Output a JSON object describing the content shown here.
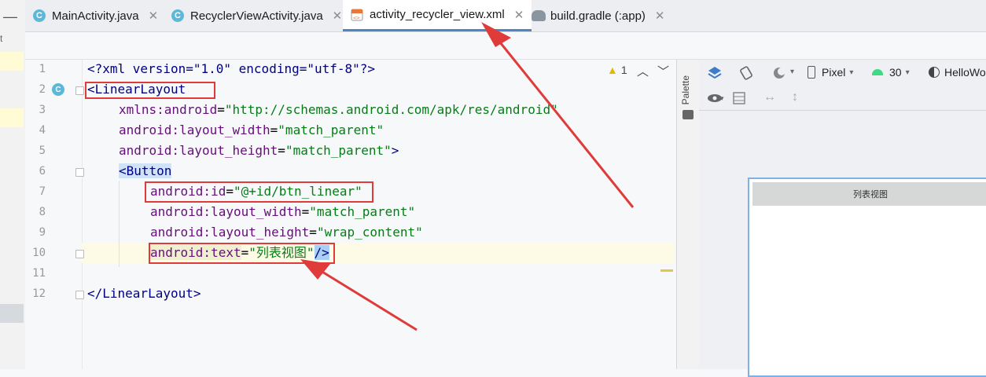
{
  "tabs": [
    {
      "label": "MainActivity.java",
      "icon": "java-class-icon",
      "glyph": "C"
    },
    {
      "label": "RecyclerViewActivity.java",
      "icon": "java-class-icon",
      "glyph": "C"
    },
    {
      "label": "activity_recycler_view.xml",
      "icon": "xml-file-icon",
      "active": true
    },
    {
      "label": "build.gradle (:app)",
      "icon": "gradle-icon"
    }
  ],
  "tab_close_glyph": "✕",
  "left_strip_letter": "t",
  "collapse_glyph": "—",
  "editor": {
    "line_numbers": [
      "1",
      "2",
      "3",
      "4",
      "5",
      "6",
      "7",
      "8",
      "9",
      "10",
      "11",
      "12"
    ],
    "lines": {
      "l1": "<?xml version=\"1.0\" encoding=\"utf-8\"?>",
      "l2": "<LinearLayout",
      "l3_attr": "xmlns:android",
      "l3_val": "\"http://schemas.android.com/apk/res/android\"",
      "l4_attr": "android:layout_width",
      "l4_val": "\"match_parent\"",
      "l5_attr": "android:layout_height",
      "l5_val": "\"match_parent\"",
      "l5_end": ">",
      "l6": "<Button",
      "l7_attr": "android:id",
      "l7_val": "\"@+id/btn_linear\"",
      "l8_attr": "android:layout_width",
      "l8_val": "\"match_parent\"",
      "l9_attr": "android:layout_height",
      "l9_val": "\"wrap_content\"",
      "l10_attr": "android:text",
      "l10_val": "\"列表视图\"",
      "l10_end": "/>",
      "l12": "</LinearLayout>"
    },
    "eq": "=",
    "warning_count": "1"
  },
  "palette_label": "Palette",
  "design": {
    "device": "Pixel",
    "api": "30",
    "theme": "HelloWo",
    "button_text": "列表视图"
  },
  "colors": {
    "accent": "#4a87c9",
    "annotation_red": "#e03b3b",
    "tag": "#000080",
    "attr": "#660e7a",
    "value": "#067d17"
  }
}
